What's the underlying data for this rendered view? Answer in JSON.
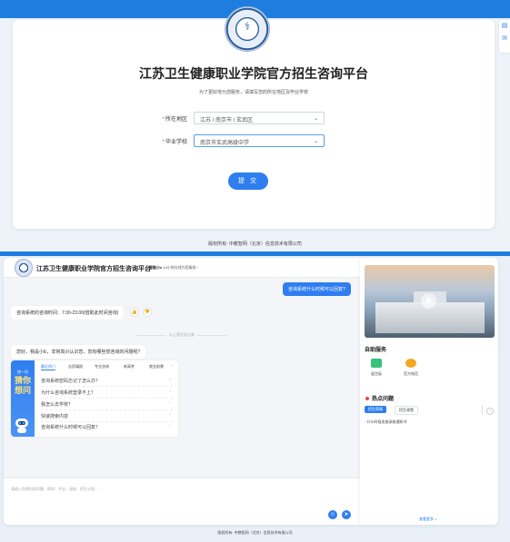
{
  "registration": {
    "title": "江苏卫生健康职业学院官方招生咨询平台",
    "subtitle": "为了更好地为您服务，请填写您的所在地区及毕业学校",
    "region_label": "所在地区",
    "region_value": "江苏 / 南京市 / 玄武区",
    "school_label": "毕业学校",
    "school_value": "南京市玄武高级中学",
    "required_mark": "*",
    "submit_label": "提 交",
    "footer": "版权所有: 中教智网（北京）信息技术有限公司"
  },
  "side_tools": [
    "▤",
    "✉"
  ],
  "chat": {
    "header_title": "江苏卫生健康职业学院官方招生咨询平台",
    "service_name": "智能小e",
    "service_tagline": "24小时在线为您服务~",
    "user_message": "咨询系统什么时候可以回复?",
    "reply_message": "咨询系统的咨询时间：7:30-23:00(借助此时间咨询)",
    "divider": "以上是历史记录",
    "greeting": "您好，我是小E，非常高兴认识您，您有哪些想咨询的问题呢?",
    "faq": {
      "banner_small": "快一问",
      "banner_big": "猜你想问",
      "tabs": [
        "最近热门",
        "志愿填报",
        "专业咨询",
        "新高考",
        "就业前景"
      ],
      "items": [
        "咨询系统密码忘记了怎么办？",
        "为什么咨询系统登录不上？",
        "我怎么去学校？",
        "快速搜索内容",
        "咨询系统什么时候可以回复？"
      ]
    },
    "input_placeholder": "请输入你想问的问题，例如：专业、录取、招生计划……",
    "emoji_icon": "☺",
    "send_icon": "➤"
  },
  "panel": {
    "self_service_title": "自助服务",
    "services": [
      "留言板",
      "官方电话"
    ],
    "hot_title": "热点问题",
    "hot_tabs": [
      "招生简章",
      "招生政策"
    ],
    "hot_item": "· 什么时候发放录取通知书",
    "view_more": "查看更多 >"
  }
}
